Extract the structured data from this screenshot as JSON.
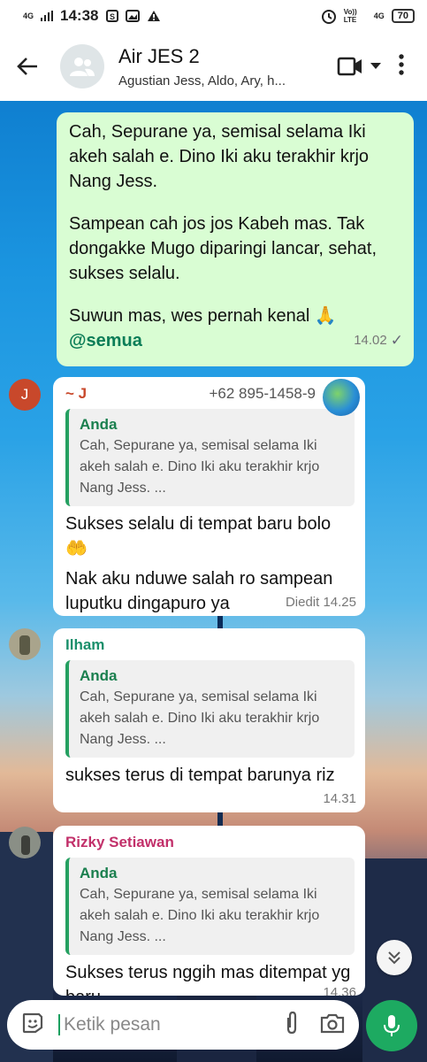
{
  "status_bar": {
    "network": "4G",
    "time": "14:38",
    "lte_label": "Vo)) LTE",
    "network2": "4G",
    "battery": "70"
  },
  "header": {
    "title": "Air JES 2",
    "members": "Agustian Jess, Aldo, Ary, h..."
  },
  "messages": {
    "outgoing": {
      "lines": [
        "Cah, Sepurane ya, semisal selama Iki akeh salah e. Dino Iki aku terakhir krjo Nang Jess.",
        "Sampean cah jos jos Kabeh mas. Tak dongakke Mugo diparingi lancar, sehat, sukses selalu.",
        "Suwun mas, wes pernah kenal 🙏"
      ],
      "mention": "@semua",
      "time": "14.02",
      "tick": "✓"
    },
    "m1": {
      "avatar_letter": "J",
      "sender": "~ J",
      "phone": "+62 895-1458-9",
      "quote_author": "Anda",
      "quote_text": "Cah, Sepurane ya, semisal selama Iki akeh salah e. Dino Iki aku terakhir krjo Nang Jess. ...",
      "text1": "Sukses selalu di tempat baru bolo",
      "emoji": "🤲",
      "text2": "Nak aku nduwe salah ro sampean luputku dingapuro ya",
      "time": "Diedit 14.25"
    },
    "m2": {
      "sender": "Ilham",
      "quote_author": "Anda",
      "quote_text": "Cah, Sepurane ya, semisal selama Iki akeh salah e. Dino Iki aku terakhir krjo Nang Jess. ...",
      "text": "sukses terus di tempat barunya riz",
      "time": "14.31"
    },
    "m3": {
      "sender": "Rizky Setiawan",
      "quote_author": "Anda",
      "quote_text": "Cah, Sepurane ya, semisal selama Iki akeh salah e. Dino Iki aku terakhir krjo Nang Jess. ...",
      "text": "Sukses terus nggih mas ditempat yg baru",
      "time": "14.36"
    }
  },
  "input": {
    "placeholder": "Ketik pesan"
  },
  "colors": {
    "header_bg": "#ffffff",
    "outgoing_bubble": "#d9fdd3",
    "accent_green": "#1daa61",
    "sender_j": "#c8482b",
    "sender_ilham": "#1a8f6b",
    "sender_rizky": "#c2306a"
  }
}
